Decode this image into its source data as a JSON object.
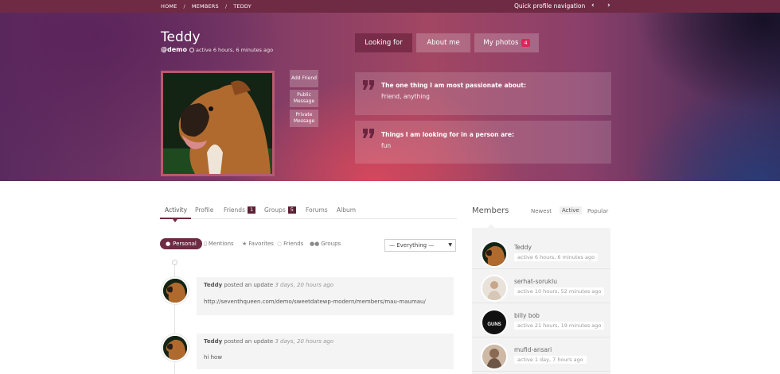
{
  "breadcrumb": [
    "HOME",
    "MEMBERS",
    "TEDDY"
  ],
  "quick_nav": {
    "label": "Quick profile navigation",
    "prev_icon": "chevron-left-icon",
    "next_icon": "chevron-right-icon"
  },
  "profile": {
    "name": "Teddy",
    "handle": "@demo",
    "last_active": "active 6 hours, 6 minutes ago"
  },
  "hero_tabs": [
    {
      "label": "Looking for",
      "active": true
    },
    {
      "label": "About me"
    },
    {
      "label": "My photos",
      "count": "4"
    }
  ],
  "actions": [
    "Add Friend",
    "Public Message",
    "Private Message"
  ],
  "about": [
    {
      "title": "The one thing I am most passionate about:",
      "text": "Friend, anything"
    },
    {
      "title": "Things I am looking for in a person are:",
      "text": "fun"
    }
  ],
  "content_tabs": [
    {
      "label": "Activity",
      "active": true
    },
    {
      "label": "Profile"
    },
    {
      "label": "Friends",
      "count": "1"
    },
    {
      "label": "Groups",
      "count": "5"
    },
    {
      "label": "Forums"
    },
    {
      "label": "Album"
    }
  ],
  "filters": {
    "personal": "Personal",
    "mentions": "Mentions",
    "favorites": "Favorites",
    "friends": "Friends",
    "groups": "Groups",
    "select_value": "— Everything —"
  },
  "activity": [
    {
      "user": "Teddy",
      "action": "posted an update",
      "time": "3 days, 20 hours ago",
      "body": "http://seventhqueen.com/demo/sweetdatewp-modern/members/mau-maumau/"
    },
    {
      "user": "Teddy",
      "action": "posted an update",
      "time": "3 days, 20 hours ago",
      "body": "hi how"
    }
  ],
  "members_widget": {
    "title": "Members",
    "tabs": [
      "Newest",
      "Active",
      "Popular"
    ],
    "active_tab": "Active",
    "list": [
      {
        "name": "Teddy",
        "active": "active 6 hours, 6 minutes ago"
      },
      {
        "name": "serhat-soruklu",
        "active": "active 10 hours, 52 minutes ago"
      },
      {
        "name": "billy bob",
        "active": "active 21 hours, 19 minutes ago",
        "avatar_text": "GUNS"
      },
      {
        "name": "mufid-ansari",
        "active": "active 1 day, 7 hours ago"
      }
    ]
  },
  "colors": {
    "accent": "#6f2b43",
    "badge": "#e0245a"
  }
}
